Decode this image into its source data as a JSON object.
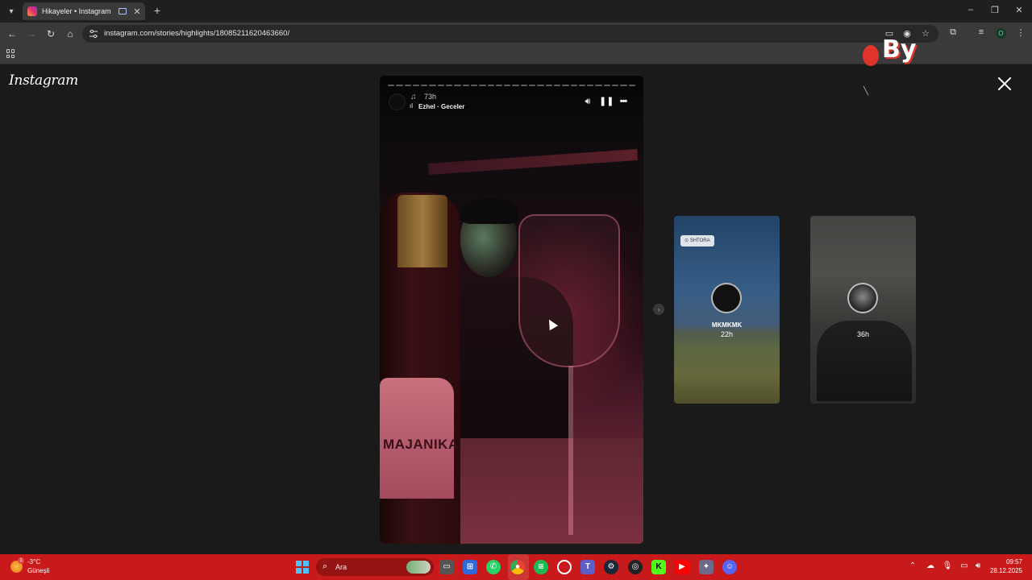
{
  "browser": {
    "tab_title": "Hikayeler • Instagram",
    "url": "instagram.com/stories/highlights/18085211620463660/",
    "profile_initial": "O"
  },
  "page": {
    "logo": "Instagram"
  },
  "story": {
    "time": "73h",
    "song": "Ezhel · Geceler",
    "bottle_label": "MAJANIKA",
    "progress_segments": 30
  },
  "previews": [
    {
      "location": "SHTORA",
      "name": "MKMKMK",
      "time": "22h"
    },
    {
      "time": "36h"
    }
  ],
  "overlay": {
    "badge": "By"
  },
  "taskbar": {
    "temperature": "-3°C",
    "weather": "Güneşli",
    "weather_badge": "1",
    "search_placeholder": "Ara",
    "clock_time": "09:57",
    "clock_date": "28.12.2025"
  },
  "colors": {
    "taskbar": "#c81a1a",
    "browser_toolbar": "#3a3a3a",
    "page_bg": "#1a1a1a"
  },
  "icons": {
    "story_controls": [
      "volume-icon",
      "pause-icon",
      "more-icon"
    ],
    "taskbar_apps": [
      "file-explorer-icon",
      "microsoft-store-icon",
      "whatsapp-icon",
      "chrome-icon",
      "spotify-icon",
      "cortana-icon",
      "teams-icon",
      "steam-icon",
      "github-icon",
      "kick-icon",
      "youtube-icon",
      "settings-icon",
      "discord-icon"
    ]
  }
}
